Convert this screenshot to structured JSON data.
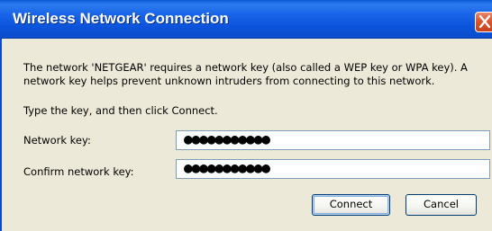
{
  "window": {
    "title": "Wireless Network Connection"
  },
  "message": {
    "line1": "The network 'NETGEAR' requires a network key (also called a WEP key or WPA key). A",
    "line2": "network key helps prevent unknown intruders from connecting to this network.",
    "instruction": "Type the key, and then click Connect."
  },
  "fields": {
    "network_key": {
      "label": "Network key:",
      "value": "●●●●●●●●●●●"
    },
    "confirm_key": {
      "label": "Confirm network key:",
      "value": "●●●●●●●●●●●"
    }
  },
  "buttons": {
    "connect": "Connect",
    "cancel": "Cancel"
  },
  "icons": {
    "close": "close-icon"
  },
  "colors": {
    "titlebar": "#0a54dc",
    "dialog_background": "#ece9d8",
    "close_button": "#d9562f"
  }
}
